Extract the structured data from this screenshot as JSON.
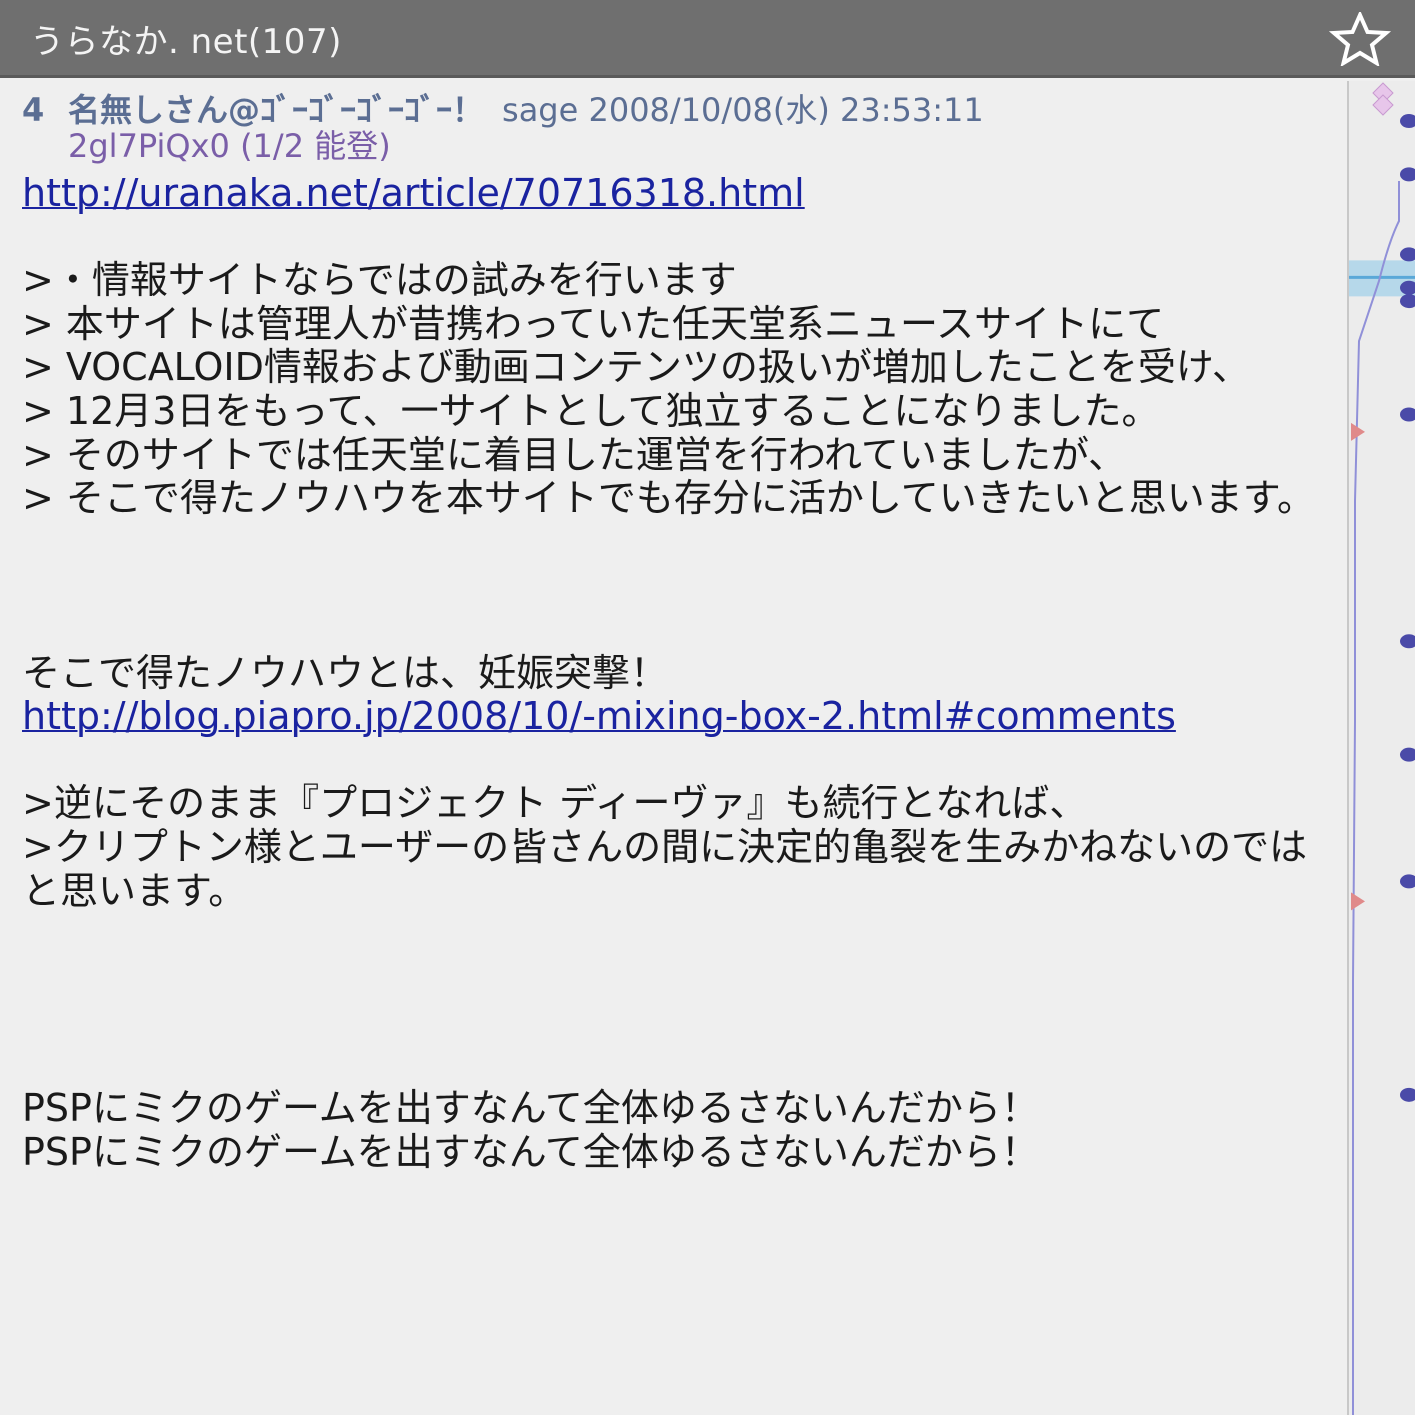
{
  "window": {
    "title": "うらなか. net(107)",
    "icons": {
      "favorite": "star-outline-icon"
    }
  },
  "post": {
    "number": "4",
    "name": "名無しさん@ｺﾞｰｺﾞｰｺﾞｰｺﾞｰ！",
    "meta": "sage 2008/10/08(水) 23:53:11",
    "id_line": "2gl7PiQx0 (1/2 能登)",
    "lines": [
      {
        "type": "link",
        "text": "http://uranaka.net/article/70716318.html"
      },
      {
        "type": "text",
        "text": ""
      },
      {
        "type": "text",
        "text": ">・情報サイトならではの試みを行います"
      },
      {
        "type": "text",
        "text": "> 本サイトは管理人が昔携わっていた任天堂系ニュースサイトにて"
      },
      {
        "type": "text",
        "text": "> VOCALOID情報および動画コンテンツの扱いが増加したことを受け、"
      },
      {
        "type": "text",
        "text": "> 12月3日をもって、一サイトとして独立することになりました。"
      },
      {
        "type": "text",
        "text": "> そのサイトでは任天堂に着目した運営を行われていましたが、"
      },
      {
        "type": "text",
        "text": "> そこで得たノウハウを本サイトでも存分に活かしていきたいと思います。"
      },
      {
        "type": "text",
        "text": ""
      },
      {
        "type": "text",
        "text": ""
      },
      {
        "type": "text",
        "text": ""
      },
      {
        "type": "text",
        "text": "そこで得たノウハウとは、妊娠突撃！"
      },
      {
        "type": "link",
        "text": "http://blog.piapro.jp/2008/10/-mixing-box-2.html#comments"
      },
      {
        "type": "text",
        "text": ""
      },
      {
        "type": "text",
        "text": ">逆にそのまま『プロジェクト ディーヴァ』も続行となれば、"
      },
      {
        "type": "text",
        "text": ">クリプトン様とユーザーの皆さんの間に決定的亀裂を生みかねないのではと思います。"
      },
      {
        "type": "text",
        "text": ""
      },
      {
        "type": "text",
        "text": ""
      },
      {
        "type": "text",
        "text": ""
      },
      {
        "type": "text",
        "text": ""
      },
      {
        "type": "text",
        "text": "PSPにミクのゲームを出すなんて全体ゆるさないんだから！"
      },
      {
        "type": "text",
        "text": "PSPにミクのゲームを出すなんて全体ゆるさないんだから！"
      }
    ]
  },
  "colors": {
    "titlebar": "#6f6f6f",
    "background": "#efefef",
    "header_text": "#5b6e93",
    "link": "#1a23a0",
    "marker_dot": "#4a4aa8",
    "scroll_thumb": "#9fd0ea"
  },
  "scroll_markers": {
    "dot_fractions": [
      0.03,
      0.07,
      0.13,
      0.155,
      0.165,
      0.25,
      0.42,
      0.505,
      0.6,
      0.76
    ],
    "triangle_fractions": [
      0.263,
      0.615
    ],
    "thumb_fraction": 0.073
  }
}
